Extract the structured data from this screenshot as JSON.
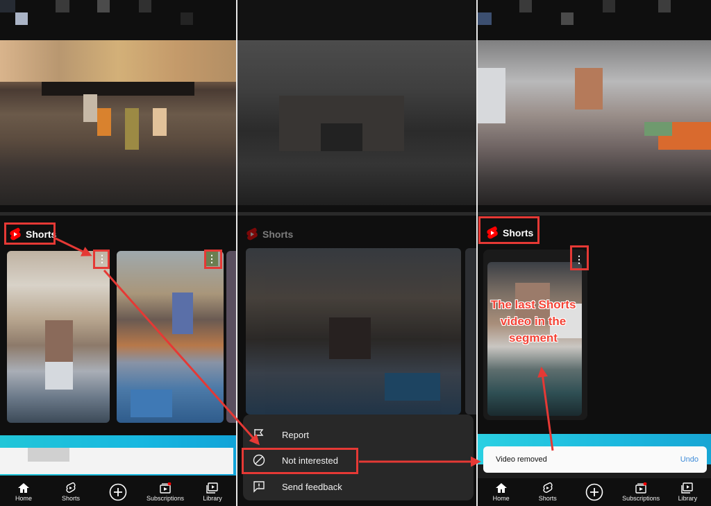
{
  "shorts_section": {
    "title": "Shorts"
  },
  "context_menu": {
    "items": [
      {
        "label": "Report",
        "icon": "flag-icon"
      },
      {
        "label": "Not interested",
        "icon": "block-icon"
      },
      {
        "label": "Send feedback",
        "icon": "feedback-icon"
      }
    ]
  },
  "toast": {
    "message": "Video removed",
    "action": "Undo"
  },
  "annotation": {
    "text": "The last Shorts video in the segment"
  },
  "bottom_nav": {
    "home": "Home",
    "shorts": "Shorts",
    "create": "",
    "subscriptions": "Subscriptions",
    "library": "Library"
  },
  "colors": {
    "annotation_red": "#e53935",
    "brand_red": "#ff0000",
    "background": "#0f0f0f",
    "menu_bg": "#282828",
    "undo_blue": "#3e8bd8"
  }
}
